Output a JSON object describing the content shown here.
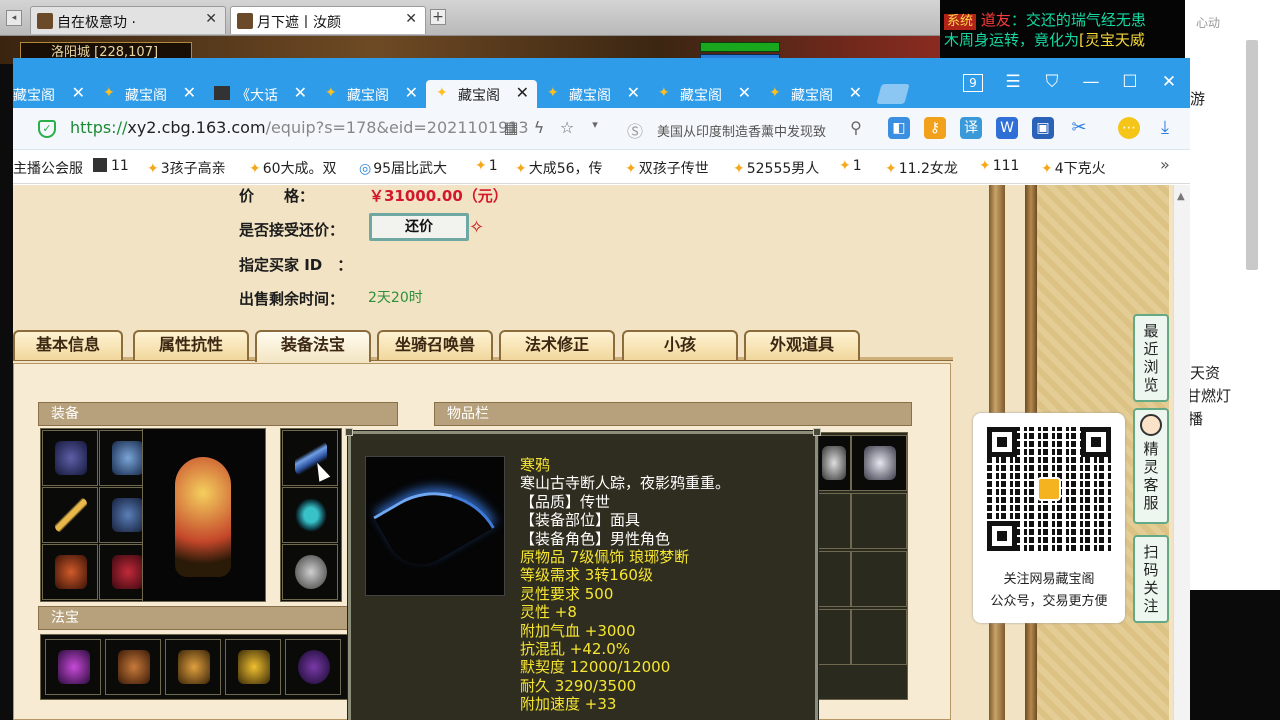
{
  "outer_browser": {
    "tabs": [
      {
        "title": "自在极意功 ·",
        "active": false
      },
      {
        "title": "月下遮丨汝颜",
        "active": true
      }
    ]
  },
  "game": {
    "location": "洛阳城 [228,107]"
  },
  "chat": {
    "tag": "系统",
    "speaker": "道友",
    "line1": "：交还的瑞气经无患",
    "line2a": "木周身运转，竟化为",
    "line2b": "[灵宝天威"
  },
  "right_panel": {
    "top_text": "心动",
    "side_text": "游",
    "text1": "天资",
    "text2": "甘燃灯",
    "text3": "播"
  },
  "browser": {
    "tabs": [
      {
        "title": "藏宝阁",
        "active": false
      },
      {
        "title": "藏宝阁",
        "active": false
      },
      {
        "title": "《大话",
        "active": false
      },
      {
        "title": "藏宝阁",
        "active": false
      },
      {
        "title": "藏宝阁",
        "active": true
      },
      {
        "title": "藏宝阁",
        "active": false
      },
      {
        "title": "藏宝阁",
        "active": false
      },
      {
        "title": "藏宝阁",
        "active": false
      }
    ],
    "window_badge": "9",
    "url_scheme": "https://",
    "url_host": "xy2.cbg.163.com",
    "url_path": "/equip?s=178&eid=2021101913",
    "search_text": "美国从印度制造香薰中发现致",
    "bookmarks": [
      "主播公会服",
      "11",
      "3孩子高亲",
      "60大成。双",
      "95届比武大",
      "1",
      "大成56，传",
      "双孩子传世",
      "52555男人",
      "1",
      "11.2女龙",
      "111",
      "4下克火"
    ],
    "bookmarks_more": "»"
  },
  "listing": {
    "price_label": "价　　格：",
    "price_value": "￥31000.00（元）",
    "counter_label": "是否接受还价：",
    "counter_button": "还价",
    "buyer_label": "指定买家 ID　：",
    "time_label": "出售剩余时间：",
    "time_value": "2天20时"
  },
  "detail_tabs": [
    "基本信息",
    "属性抗性",
    "装备法宝",
    "坐骑召唤兽",
    "法术修正",
    "小孩",
    "外观道具"
  ],
  "active_detail_tab": "装备法宝",
  "sections": {
    "equipment": "装备",
    "inventory": "物品栏",
    "treasure": "法宝"
  },
  "tooltip": {
    "name": "寒鸦",
    "desc": "寒山古寺断人踪，夜影鸦重重。",
    "lines": [
      {
        "text": "【品质】传世",
        "tone": "w"
      },
      {
        "text": "【装备部位】面具",
        "tone": "w"
      },
      {
        "text": "【装备角色】男性角色",
        "tone": "w"
      },
      {
        "text": "原物品 7级佩饰 琅琊梦断",
        "tone": "y"
      },
      {
        "text": "等级需求 3转160级",
        "tone": "y"
      },
      {
        "text": "灵性要求 500",
        "tone": "y"
      },
      {
        "text": "灵性 +8",
        "tone": "y"
      },
      {
        "text": "附加气血 +3000",
        "tone": "y"
      },
      {
        "text": "抗混乱 +42.0%",
        "tone": "y"
      },
      {
        "text": "默契度 12000/12000",
        "tone": "y"
      },
      {
        "text": "耐久 3290/3500",
        "tone": "y"
      },
      {
        "text": "附加速度 +33",
        "tone": "y"
      }
    ]
  },
  "qr_card": {
    "line1": "关注网易藏宝阁",
    "line2": "公众号，交易更方便"
  },
  "side_buttons": {
    "recent": [
      "最",
      "近",
      "浏",
      "览"
    ],
    "service": [
      "精",
      "灵",
      "客",
      "服"
    ],
    "scan": [
      "扫",
      "码",
      "关",
      "注"
    ]
  },
  "colors": {
    "tab_bar": "#2f9ce9",
    "price_red": "#d3182b",
    "time_green": "#2d8f3a",
    "tooltip_yellow": "#f7e631"
  }
}
